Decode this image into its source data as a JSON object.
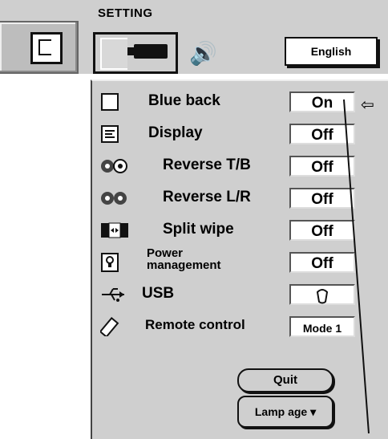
{
  "header": {
    "title": "SETTING",
    "language": "English"
  },
  "menu": {
    "items": [
      {
        "label": "Blue back",
        "value": "On",
        "icon": "blank-screen-icon"
      },
      {
        "label": "Display",
        "value": "Off",
        "icon": "display-icon"
      },
      {
        "label": "Reverse T/B",
        "value": "Off",
        "icon": "reverse-tb-icon"
      },
      {
        "label": "Reverse L/R",
        "value": "Off",
        "icon": "reverse-lr-icon"
      },
      {
        "label": "Split wipe",
        "value": "Off",
        "icon": "split-wipe-icon"
      },
      {
        "label_line1": "Power",
        "label_line2": "management",
        "value": "Off",
        "icon": "bulb-icon"
      },
      {
        "label": "USB",
        "value": "",
        "icon": "usb-icon",
        "value_icon": "mouse-icon"
      },
      {
        "label": "Remote control",
        "value": "Mode 1",
        "icon": "remote-icon"
      }
    ],
    "quit_label": "Quit",
    "lamp_age_label": "Lamp age ▾"
  }
}
